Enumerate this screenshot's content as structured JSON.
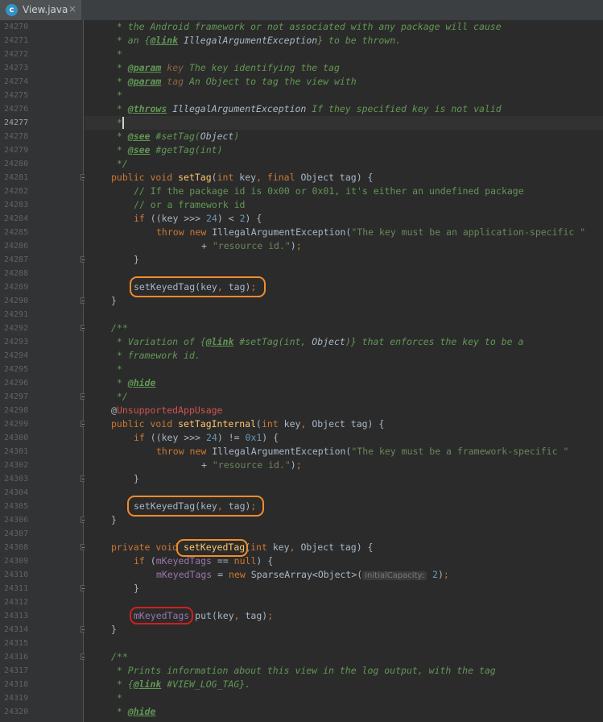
{
  "tab": {
    "icon": "c-class-icon",
    "icon_letter": "c",
    "title": "View.java",
    "close": "×"
  },
  "colors": {
    "orange_highlight": "#f28c2c",
    "red_highlight": "#d01f1f",
    "background": "#2b2b2b"
  },
  "current_line": "24277",
  "lines": [
    {
      "n": "24270",
      "ind": 0,
      "t": [
        [
          "c-doc",
          " * the Android framework or not associated with any package will cause"
        ]
      ]
    },
    {
      "n": "24271",
      "ind": 0,
      "t": [
        [
          "c-doc",
          " * an {"
        ],
        [
          "c-tagl",
          "@link"
        ],
        [
          "c-doc",
          " "
        ],
        [
          "c-italic",
          "IllegalArgumentException"
        ],
        [
          "c-doc",
          "} to be thrown."
        ]
      ]
    },
    {
      "n": "24272",
      "ind": 0,
      "t": [
        [
          "c-doc",
          " *"
        ]
      ]
    },
    {
      "n": "24273",
      "ind": 0,
      "t": [
        [
          "c-doc",
          " * "
        ],
        [
          "c-tag",
          "@param"
        ],
        [
          "c-doc",
          " "
        ],
        [
          "c-ref",
          "key"
        ],
        [
          "c-doc",
          " The key identifying the tag"
        ]
      ]
    },
    {
      "n": "24274",
      "ind": 0,
      "t": [
        [
          "c-doc",
          " * "
        ],
        [
          "c-tag",
          "@param"
        ],
        [
          "c-doc",
          " "
        ],
        [
          "c-ref",
          "tag"
        ],
        [
          "c-doc",
          " An Object to tag the view with"
        ]
      ]
    },
    {
      "n": "24275",
      "ind": 0,
      "t": [
        [
          "c-doc",
          " *"
        ]
      ]
    },
    {
      "n": "24276",
      "ind": 0,
      "t": [
        [
          "c-doc",
          " * "
        ],
        [
          "c-tag",
          "@throws"
        ],
        [
          "c-doc",
          " "
        ],
        [
          "c-italic",
          "IllegalArgumentException"
        ],
        [
          "c-doc",
          " If they specified key is not valid"
        ]
      ]
    },
    {
      "n": "24277",
      "ind": 0,
      "t": [
        [
          "c-doc",
          " *"
        ]
      ]
    },
    {
      "n": "24278",
      "ind": 0,
      "t": [
        [
          "c-doc",
          " * "
        ],
        [
          "c-tag",
          "@see"
        ],
        [
          "c-doc",
          " #setTag("
        ],
        [
          "c-italic",
          "Object"
        ],
        [
          "c-doc",
          ")"
        ]
      ]
    },
    {
      "n": "24279",
      "ind": 0,
      "t": [
        [
          "c-doc",
          " * "
        ],
        [
          "c-tag",
          "@see"
        ],
        [
          "c-doc",
          " #getTag(int)"
        ]
      ]
    },
    {
      "n": "24280",
      "ind": 0,
      "t": [
        [
          "c-doc",
          " */"
        ]
      ]
    },
    {
      "n": "24281",
      "ind": 0,
      "t": [
        [
          "c-kw",
          "public void "
        ],
        [
          "c-fn",
          "setTag"
        ],
        [
          "c-plain",
          "("
        ],
        [
          "c-kw",
          "int "
        ],
        [
          "c-plain",
          "key"
        ],
        [
          "c-kw",
          ", final "
        ],
        [
          "c-plain",
          "Object tag) {"
        ]
      ]
    },
    {
      "n": "24282",
      "ind": 1,
      "t": [
        [
          "c-cmt",
          "// If the package id is 0x00 or 0x01, it's either an undefined package"
        ]
      ]
    },
    {
      "n": "24283",
      "ind": 1,
      "t": [
        [
          "c-cmt",
          "// or a framework id"
        ]
      ]
    },
    {
      "n": "24284",
      "ind": 1,
      "t": [
        [
          "c-kw",
          "if "
        ],
        [
          "c-plain",
          "((key >>> "
        ],
        [
          "c-num",
          "24"
        ],
        [
          "c-plain",
          ") < "
        ],
        [
          "c-num",
          "2"
        ],
        [
          "c-plain",
          ") {"
        ]
      ]
    },
    {
      "n": "24285",
      "ind": 2,
      "t": [
        [
          "c-kw",
          "throw new "
        ],
        [
          "c-plain",
          "IllegalArgumentException("
        ],
        [
          "c-str",
          "\"The key must be an application-specific \""
        ]
      ]
    },
    {
      "n": "24286",
      "ind": 4,
      "t": [
        [
          "c-plain",
          "+ "
        ],
        [
          "c-str",
          "\"resource id.\""
        ],
        [
          "c-plain",
          ")"
        ],
        [
          "c-kw",
          ";"
        ]
      ]
    },
    {
      "n": "24287",
      "ind": 1,
      "t": [
        [
          "c-plain",
          "}"
        ]
      ]
    },
    {
      "n": "24288",
      "ind": 0,
      "t": []
    },
    {
      "n": "24289",
      "ind": 1,
      "t": [
        [
          "c-plain",
          "setKeyedTag(key"
        ],
        [
          "c-kw",
          ", "
        ],
        [
          "c-plain",
          "tag)"
        ],
        [
          "c-kw",
          ";"
        ]
      ]
    },
    {
      "n": "24290",
      "ind": 0,
      "t": [
        [
          "c-plain",
          "}"
        ]
      ]
    },
    {
      "n": "24291",
      "ind": 0,
      "t": []
    },
    {
      "n": "24292",
      "ind": 0,
      "t": [
        [
          "c-doc",
          "/**"
        ]
      ]
    },
    {
      "n": "24293",
      "ind": 0,
      "t": [
        [
          "c-doc",
          " * Variation of {"
        ],
        [
          "c-tagl",
          "@link"
        ],
        [
          "c-doc",
          " #setTag(int, "
        ],
        [
          "c-italic",
          "Object"
        ],
        [
          "c-doc",
          ")} that enforces the key to be a"
        ]
      ]
    },
    {
      "n": "24294",
      "ind": 0,
      "t": [
        [
          "c-doc",
          " * framework id."
        ]
      ]
    },
    {
      "n": "24295",
      "ind": 0,
      "t": [
        [
          "c-doc",
          " *"
        ]
      ]
    },
    {
      "n": "24296",
      "ind": 0,
      "t": [
        [
          "c-doc",
          " * "
        ],
        [
          "c-tag",
          "@hide"
        ]
      ]
    },
    {
      "n": "24297",
      "ind": 0,
      "t": [
        [
          "c-doc",
          " */"
        ]
      ]
    },
    {
      "n": "24298",
      "ind": 0,
      "t": [
        [
          "c-plain",
          "@"
        ],
        [
          "c-red",
          "UnsupportedAppUsage"
        ]
      ]
    },
    {
      "n": "24299",
      "ind": 0,
      "t": [
        [
          "c-kw",
          "public void "
        ],
        [
          "c-fn",
          "setTagInternal"
        ],
        [
          "c-plain",
          "("
        ],
        [
          "c-kw",
          "int "
        ],
        [
          "c-plain",
          "key"
        ],
        [
          "c-kw",
          ", "
        ],
        [
          "c-plain",
          "Object tag) {"
        ]
      ]
    },
    {
      "n": "24300",
      "ind": 1,
      "t": [
        [
          "c-kw",
          "if "
        ],
        [
          "c-plain",
          "((key >>> "
        ],
        [
          "c-num",
          "24"
        ],
        [
          "c-plain",
          ") != "
        ],
        [
          "c-num",
          "0x1"
        ],
        [
          "c-plain",
          ") {"
        ]
      ]
    },
    {
      "n": "24301",
      "ind": 2,
      "t": [
        [
          "c-kw",
          "throw new "
        ],
        [
          "c-plain",
          "IllegalArgumentException("
        ],
        [
          "c-str",
          "\"The key must be a framework-specific \""
        ]
      ]
    },
    {
      "n": "24302",
      "ind": 4,
      "t": [
        [
          "c-plain",
          "+ "
        ],
        [
          "c-str",
          "\"resource id.\""
        ],
        [
          "c-plain",
          ")"
        ],
        [
          "c-kw",
          ";"
        ]
      ]
    },
    {
      "n": "24303",
      "ind": 1,
      "t": [
        [
          "c-plain",
          "}"
        ]
      ]
    },
    {
      "n": "24304",
      "ind": 0,
      "t": []
    },
    {
      "n": "24305",
      "ind": 1,
      "t": [
        [
          "c-plain",
          "setKeyedTag(key"
        ],
        [
          "c-kw",
          ", "
        ],
        [
          "c-plain",
          "tag)"
        ],
        [
          "c-kw",
          ";"
        ]
      ]
    },
    {
      "n": "24306",
      "ind": 0,
      "t": [
        [
          "c-plain",
          "}"
        ]
      ]
    },
    {
      "n": "24307",
      "ind": 0,
      "t": []
    },
    {
      "n": "24308",
      "ind": 0,
      "t": [
        [
          "c-kw",
          "private void "
        ],
        [
          "c-fn",
          "setKeyedTag"
        ],
        [
          "c-plain",
          "("
        ],
        [
          "c-kw",
          "int "
        ],
        [
          "c-plain",
          "key"
        ],
        [
          "c-kw",
          ", "
        ],
        [
          "c-plain",
          "Object tag) {"
        ]
      ]
    },
    {
      "n": "24309",
      "ind": 1,
      "t": [
        [
          "c-kw",
          "if "
        ],
        [
          "c-plain",
          "("
        ],
        [
          "c-field",
          "mKeyedTags"
        ],
        [
          "c-plain",
          " == "
        ],
        [
          "c-kw",
          "null"
        ],
        [
          "c-plain",
          ") {"
        ]
      ]
    },
    {
      "n": "24310",
      "ind": 2,
      "t": [
        [
          "c-field",
          "mKeyedTags"
        ],
        [
          "c-plain",
          " = "
        ],
        [
          "c-kw",
          "new "
        ],
        [
          "c-plain",
          "SparseArray<Object>("
        ],
        [
          "c-hint",
          "initialCapacity:"
        ],
        [
          "c-plain",
          " "
        ],
        [
          "c-num",
          "2"
        ],
        [
          "c-plain",
          ")"
        ],
        [
          "c-kw",
          ";"
        ]
      ]
    },
    {
      "n": "24311",
      "ind": 1,
      "t": [
        [
          "c-plain",
          "}"
        ]
      ]
    },
    {
      "n": "24312",
      "ind": 0,
      "t": []
    },
    {
      "n": "24313",
      "ind": 1,
      "t": [
        [
          "c-field",
          "mKeyedTags"
        ],
        [
          "c-plain",
          ".put(key"
        ],
        [
          "c-kw",
          ", "
        ],
        [
          "c-plain",
          "tag)"
        ],
        [
          "c-kw",
          ";"
        ]
      ]
    },
    {
      "n": "24314",
      "ind": 0,
      "t": [
        [
          "c-plain",
          "}"
        ]
      ]
    },
    {
      "n": "24315",
      "ind": 0,
      "t": []
    },
    {
      "n": "24316",
      "ind": 0,
      "t": [
        [
          "c-doc",
          "/**"
        ]
      ]
    },
    {
      "n": "24317",
      "ind": 0,
      "t": [
        [
          "c-doc",
          " * Prints information about this view in the log output, with the tag"
        ]
      ]
    },
    {
      "n": "24318",
      "ind": 0,
      "t": [
        [
          "c-doc",
          " * {"
        ],
        [
          "c-tagl",
          "@link"
        ],
        [
          "c-doc",
          " #VIEW_LOG_TAG}."
        ]
      ]
    },
    {
      "n": "24319",
      "ind": 0,
      "t": [
        [
          "c-doc",
          " *"
        ]
      ]
    },
    {
      "n": "24320",
      "ind": 0,
      "t": [
        [
          "c-doc",
          " * "
        ],
        [
          "c-tag",
          "@hide"
        ]
      ]
    }
  ]
}
